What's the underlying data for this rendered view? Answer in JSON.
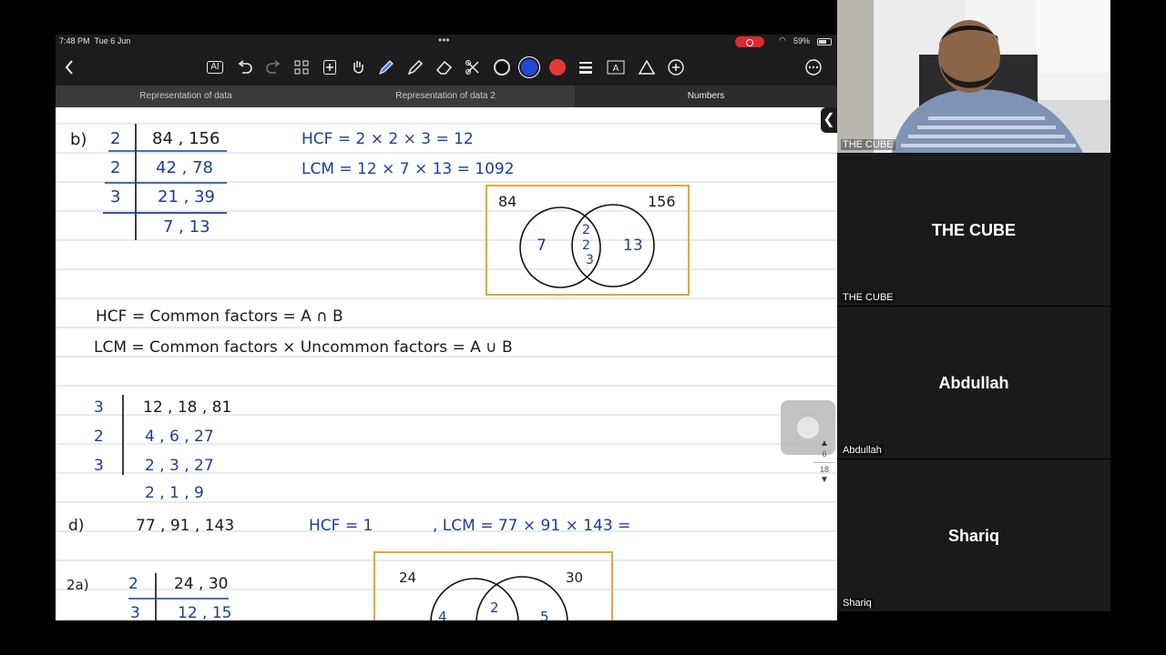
{
  "status_bar": {
    "time": "7:48 PM",
    "date": "Tue 6 Jun",
    "battery": "59%"
  },
  "toolbar": {
    "icons": [
      "back-chevron-icon",
      "ai-text-icon",
      "undo-icon",
      "redo-icon",
      "grid-icon",
      "add-page-icon",
      "hand-icon",
      "pen-icon",
      "highlighter-icon",
      "eraser-icon",
      "lasso-icon",
      "color-black",
      "color-blue",
      "color-red",
      "line-weight-icon",
      "text-box-icon",
      "shapes-icon",
      "add-icon",
      "more-icon"
    ],
    "ai_label": "AI",
    "colors": {
      "black": "#111111",
      "blue": "#1e4bd8",
      "red": "#e53935"
    }
  },
  "tabs": [
    {
      "label": "Representation of data"
    },
    {
      "label": "Representation of data 2"
    },
    {
      "label": "Numbers"
    }
  ],
  "note": {
    "b_label": "b)",
    "b_divisors": [
      "2",
      "2",
      "3"
    ],
    "b_rows": [
      "84 , 156",
      "42 , 78",
      "21 , 39",
      "7 , 13"
    ],
    "hcf_line": "HCF = 2 × 2 × 3 = 12",
    "lcm_line": "LCM = 12 × 7 × 13 = 1092",
    "venn1": {
      "a_label": "84",
      "b_label": "156",
      "left": "7",
      "mid": [
        "2",
        "2",
        "3"
      ],
      "right": "13"
    },
    "def_hcf": "HCF = Common factors = A ∩ B",
    "def_lcm": "LCM = Common factors × Uncommon factors = A ∪ B",
    "c_divisors": [
      "3",
      "2",
      "3"
    ],
    "c_rows": [
      "12 , 18 , 81",
      "4 , 6 , 27",
      "2 , 3 , 27",
      "2 , 1 , 9"
    ],
    "d_label": "d)",
    "d_numbers": "77 , 91 , 143",
    "d_hcf": "HCF = 1",
    "d_lcm": ", LCM = 77 × 91 × 143 =",
    "q2_label": "2a)",
    "q2_divisors": [
      "2",
      "3"
    ],
    "q2_rows": [
      "24 , 30",
      "12 , 15"
    ],
    "venn2": {
      "a_label": "24",
      "b_label": "30",
      "left": "4",
      "mid": "2",
      "right": "5"
    }
  },
  "pager": {
    "current": "6",
    "total": "18"
  },
  "participants": [
    {
      "tag": "THE CUBE",
      "big": ""
    },
    {
      "tag": "THE CUBE",
      "big": "THE CUBE"
    },
    {
      "tag": "Abdullah",
      "big": "Abdullah"
    },
    {
      "tag": "Shariq",
      "big": "Shariq"
    }
  ]
}
